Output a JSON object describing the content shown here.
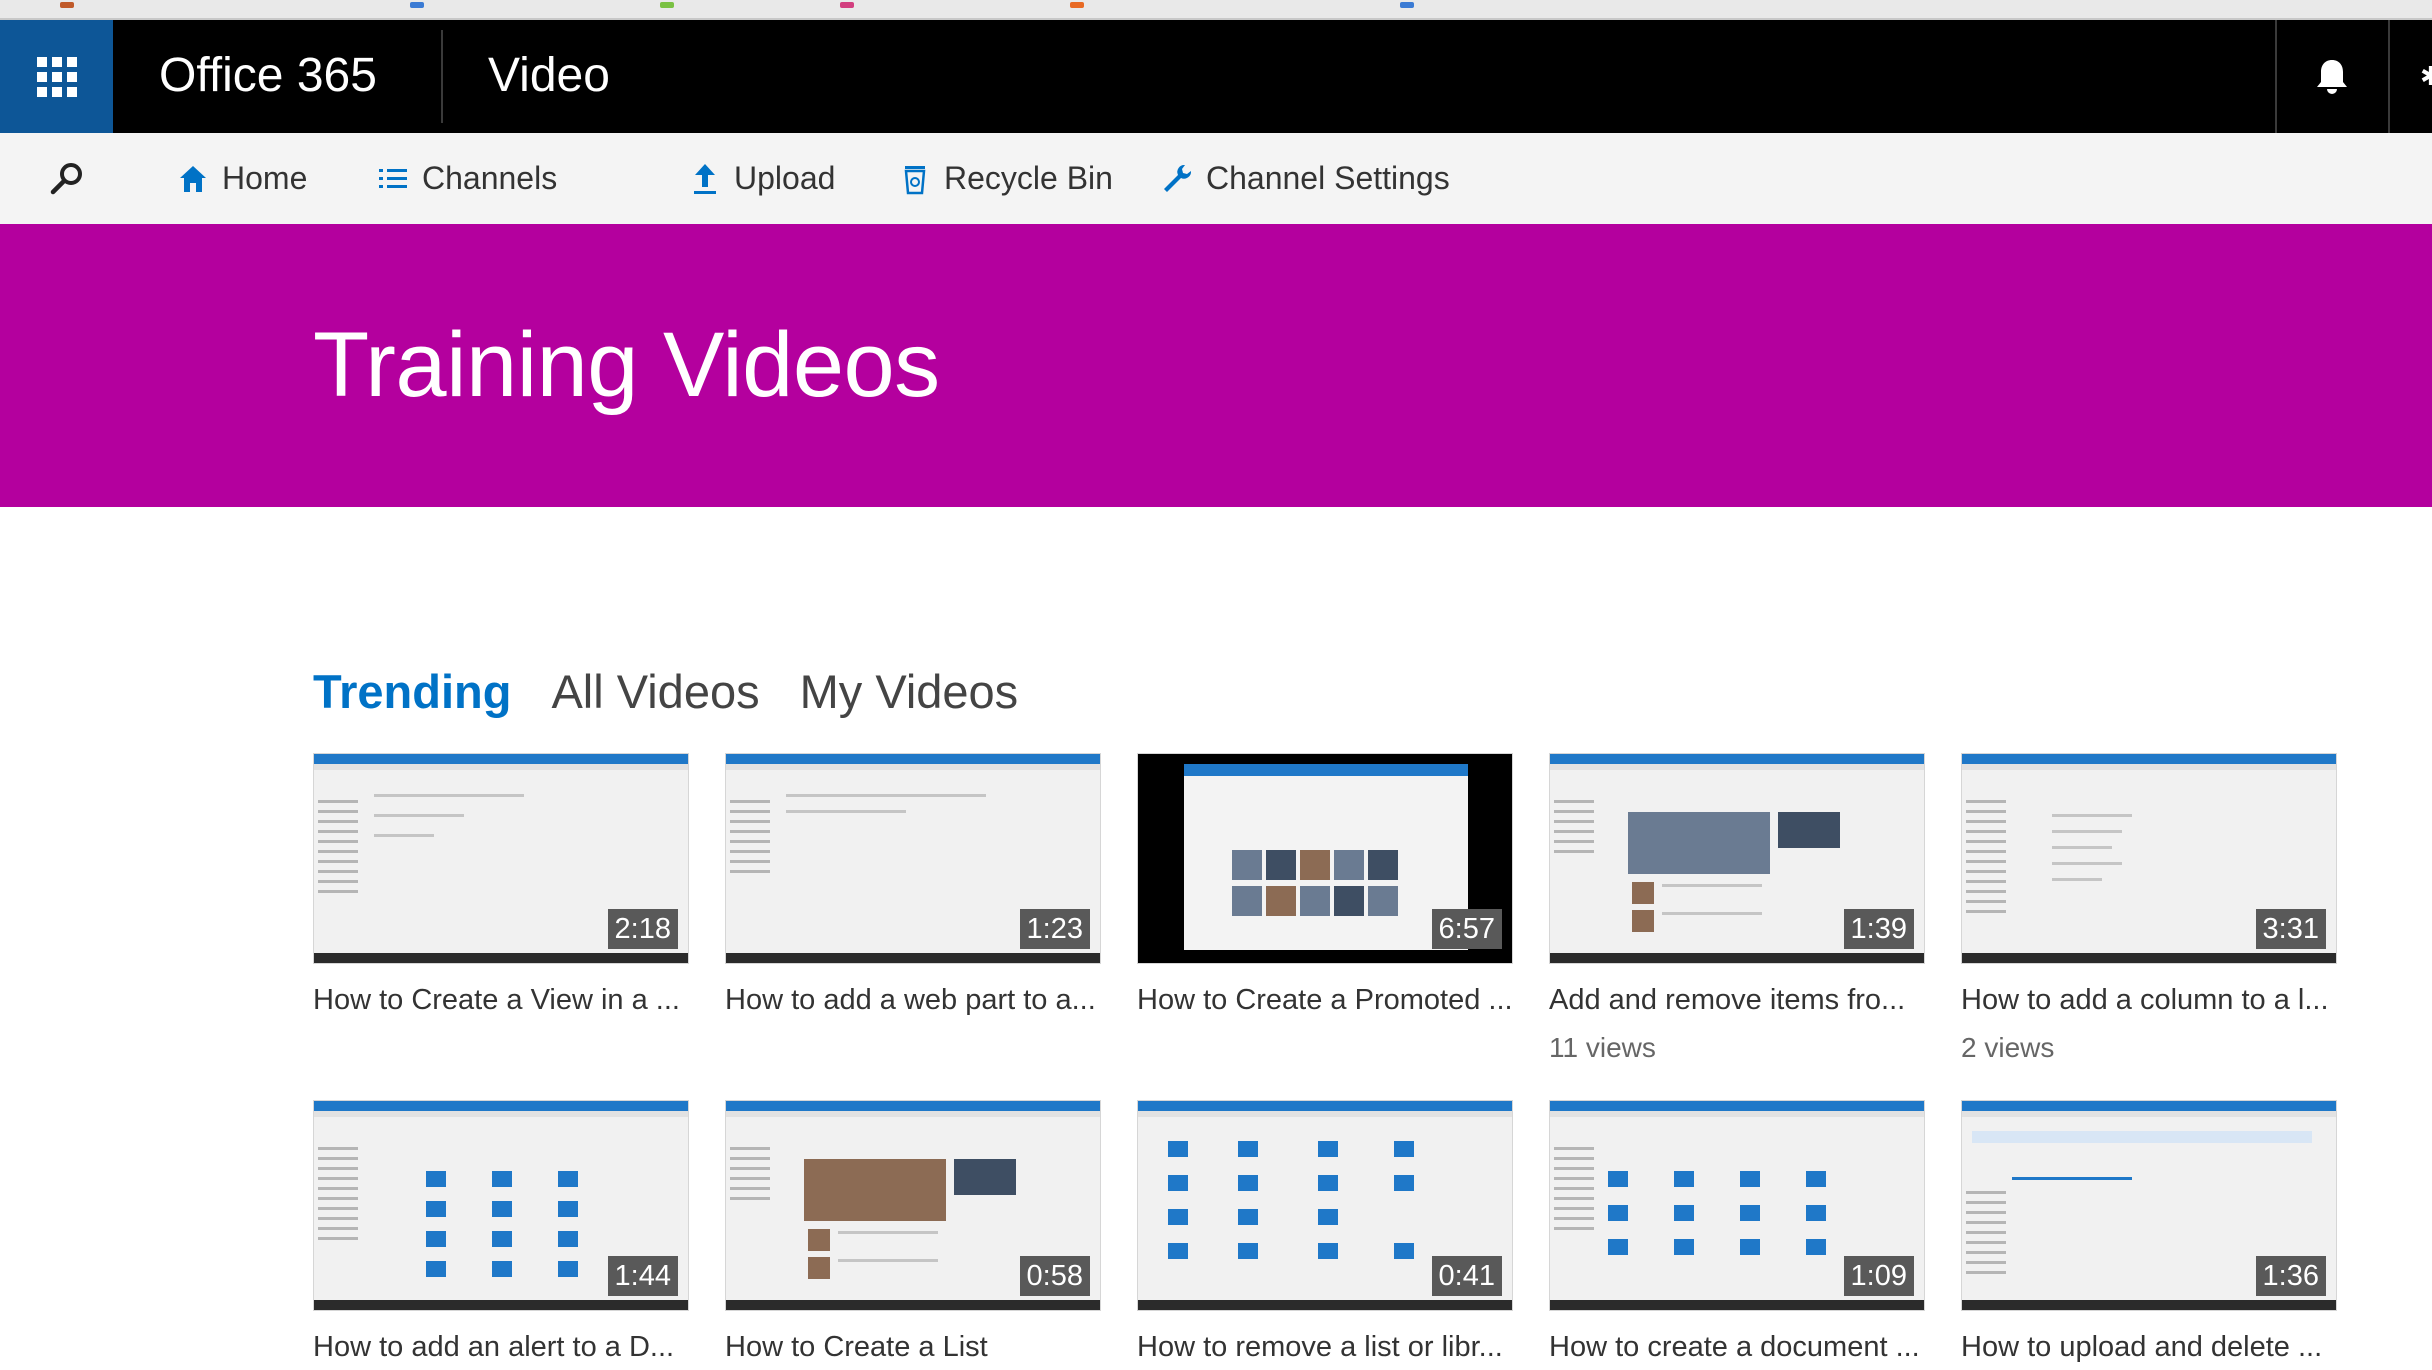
{
  "suite_bar": {
    "title": "Office 365",
    "app_name": "Video"
  },
  "command_bar": {
    "items": [
      {
        "label": "Home",
        "icon": "home-icon"
      },
      {
        "label": "Channels",
        "icon": "list-icon"
      },
      {
        "label": "Upload",
        "icon": "upload-icon"
      },
      {
        "label": "Recycle Bin",
        "icon": "recycle-bin-icon"
      },
      {
        "label": "Channel Settings",
        "icon": "wrench-icon"
      }
    ]
  },
  "banner": {
    "title": "Training Videos",
    "color": "#b4009e"
  },
  "tabs": [
    {
      "label": "Trending",
      "active": true
    },
    {
      "label": "All Videos",
      "active": false
    },
    {
      "label": "My Videos",
      "active": false
    }
  ],
  "videos": [
    {
      "title": "How to Create a View in a ...",
      "duration": "2:18",
      "views": ""
    },
    {
      "title": "How to add a web part to a...",
      "duration": "1:23",
      "views": ""
    },
    {
      "title": "How to Create a Promoted ...",
      "duration": "6:57",
      "views": ""
    },
    {
      "title": "Add and remove items fro...",
      "duration": "1:39",
      "views": "11 views"
    },
    {
      "title": "How to add a column to a l...",
      "duration": "3:31",
      "views": "2 views"
    },
    {
      "title": "How to add an alert to a D...",
      "duration": "1:44",
      "views": ""
    },
    {
      "title": "How to Create a List",
      "duration": "0:58",
      "views": ""
    },
    {
      "title": "How to remove a list or libr...",
      "duration": "0:41",
      "views": ""
    },
    {
      "title": "How to create a document ...",
      "duration": "1:09",
      "views": ""
    },
    {
      "title": "How to upload and delete ...",
      "duration": "1:36",
      "views": ""
    }
  ],
  "colors": {
    "accent": "#0072c6",
    "suite_bar": "#000000",
    "waffle": "#0d5697"
  }
}
